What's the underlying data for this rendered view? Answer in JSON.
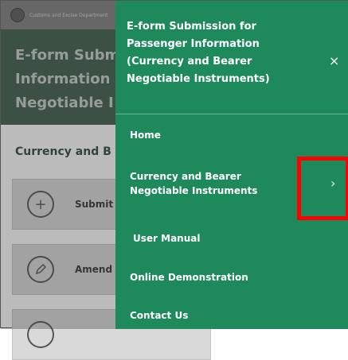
{
  "header": {
    "org_text": "Customs and Excise Department"
  },
  "hero": {
    "lines": [
      "E-form Subm",
      "Information",
      "Negotiable I"
    ]
  },
  "section_title": "Currency and B",
  "cards": [
    {
      "label": "Submit",
      "icon": "plus-circle-icon"
    },
    {
      "label": "Amend",
      "icon": "pencil-circle-icon"
    }
  ],
  "drawer": {
    "title_lines": [
      "E-form Submission for",
      "Passenger Information",
      "(Currency and Bearer",
      "Negotiable Instruments)"
    ],
    "close_symbol": "×",
    "items": [
      {
        "label": "Home"
      },
      {
        "label_lines": [
          "Currency and Bearer",
          "Negotiable Instruments"
        ],
        "chevron": "›"
      },
      {
        "label": "User Manual"
      },
      {
        "label": "Online Demonstration"
      },
      {
        "label": "Contact Us"
      }
    ]
  },
  "colors": {
    "drawer": "#1e8a5c",
    "highlight": "#ff0000"
  }
}
